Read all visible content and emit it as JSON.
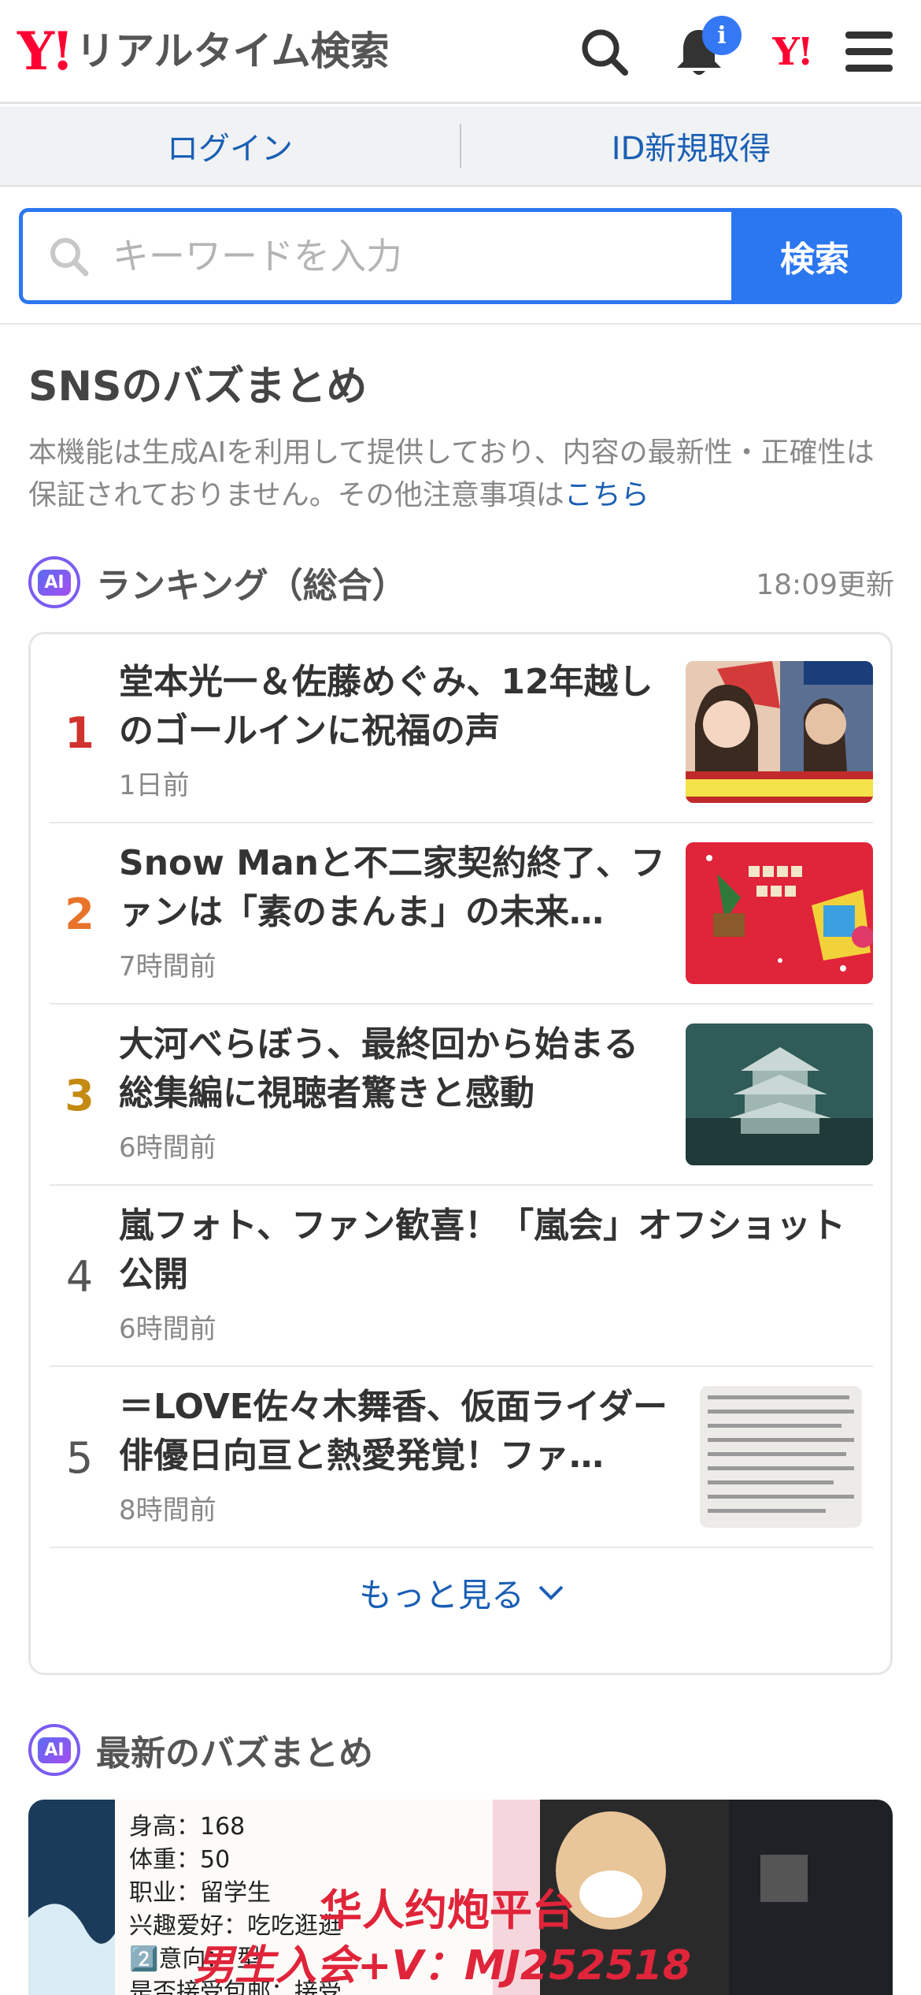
{
  "header": {
    "logo_mark": "Y!",
    "logo_text": "リアルタイム検索",
    "notification_badge": "i",
    "yahoo_small": "Y!"
  },
  "login_bar": {
    "login_label": "ログイン",
    "register_label": "ID新規取得"
  },
  "search": {
    "placeholder": "キーワードを入力",
    "button_label": "検索"
  },
  "buzz": {
    "title": "SNSのバズまとめ",
    "notice_text": "本機能は生成AIを利用して提供しており、内容の最新性・正確性は保証されておりません。その他注意事項は",
    "notice_link": "こちら"
  },
  "ranking": {
    "ai_label": "AI",
    "title": "ランキング（総合）",
    "updated": "18:09更新",
    "items": [
      {
        "rank": "1",
        "title": "堂本光一＆佐藤めぐみ、12年越しのゴールインに祝福の声",
        "time": "1日前",
        "rank_color": "#d0322d"
      },
      {
        "rank": "2",
        "title": "Snow Manと不二家契約終了、ファンは「素のまんま」の未来…",
        "time": "7時間前",
        "rank_color": "#e8732a"
      },
      {
        "rank": "3",
        "title": "大河べらぼう、最終回から始まる総集編に視聴者驚きと感動",
        "time": "6時間前",
        "rank_color": "#c48a12"
      },
      {
        "rank": "4",
        "title": "嵐フォト、ファン歓喜！「嵐会」オフショット公開",
        "time": "6時間前",
        "rank_color": "#555555"
      },
      {
        "rank": "5",
        "title": "＝LOVE佐々木舞香、仮面ライダー俳優日向亘と熱愛発覚！ファ…",
        "time": "8時間前",
        "rank_color": "#555555"
      }
    ],
    "more_label": "もっと見る"
  },
  "latest": {
    "ai_label": "AI",
    "title": "最新のバズまとめ",
    "banner_lines": [
      "身高：168",
      "体重：50",
      "职业：留学生",
      "兴趣爱好：吃吃逛逛",
      "2️⃣意向：  型",
      "是否接受包邮：接受"
    ],
    "banner_overlay_1": "华人约炮平台",
    "banner_overlay_2": "男生入会+V：MJ252518"
  },
  "colors": {
    "accent": "#2b77f0",
    "link": "#1a5fb4",
    "yahoo_red": "#ff0033"
  }
}
